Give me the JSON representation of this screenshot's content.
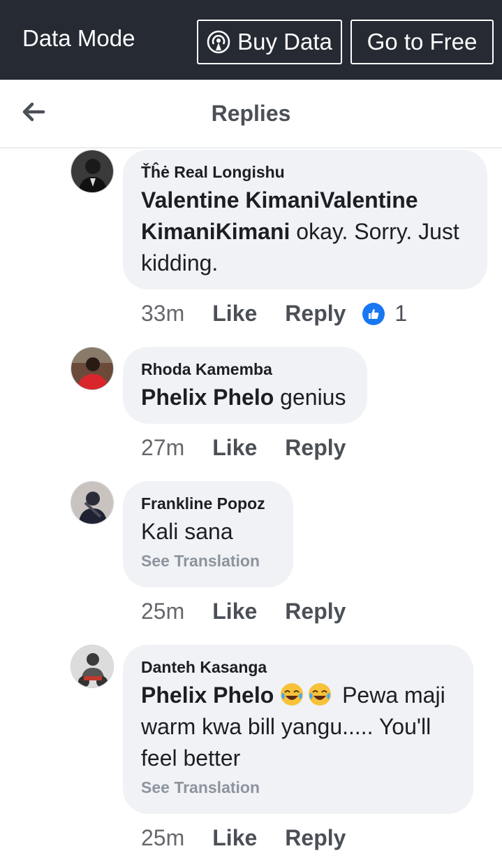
{
  "topbar": {
    "mode_label": "Data Mode",
    "buy_label": "Buy Data",
    "free_label": "Go to Free"
  },
  "header": {
    "title": "Replies"
  },
  "comments": [
    {
      "author": "Ťĥė Real Longishu",
      "mention": "Valentine KimaniValentine KimaniKimani",
      "text": " okay. Sorry. Just kidding.",
      "time": "33m",
      "like": "Like",
      "reply": "Reply",
      "reaction_count": "1"
    },
    {
      "author": "Rhoda Kamemba",
      "mention": "Phelix Phelo",
      "text": " genius",
      "time": "27m",
      "like": "Like",
      "reply": "Reply"
    },
    {
      "author": "Frankline Popoz",
      "text": "Kali sana",
      "see_translation": "See Translation",
      "time": "25m",
      "like": "Like",
      "reply": "Reply"
    },
    {
      "author": "Danteh Kasanga",
      "mention": "Phelix Phelo",
      "emojis": [
        "face-with-tears-of-joy-icon",
        "face-with-tears-of-joy-icon"
      ],
      "text": " Pewa maji warm kwa bill yangu..... You'll feel better",
      "see_translation": "See Translation",
      "time": "25m",
      "like": "Like",
      "reply": "Reply"
    }
  ],
  "colors": {
    "topbar_bg": "#252a33",
    "bubble_bg": "#f0f2f5",
    "like_blue": "#1877f2",
    "meta_gray": "#65676b"
  }
}
